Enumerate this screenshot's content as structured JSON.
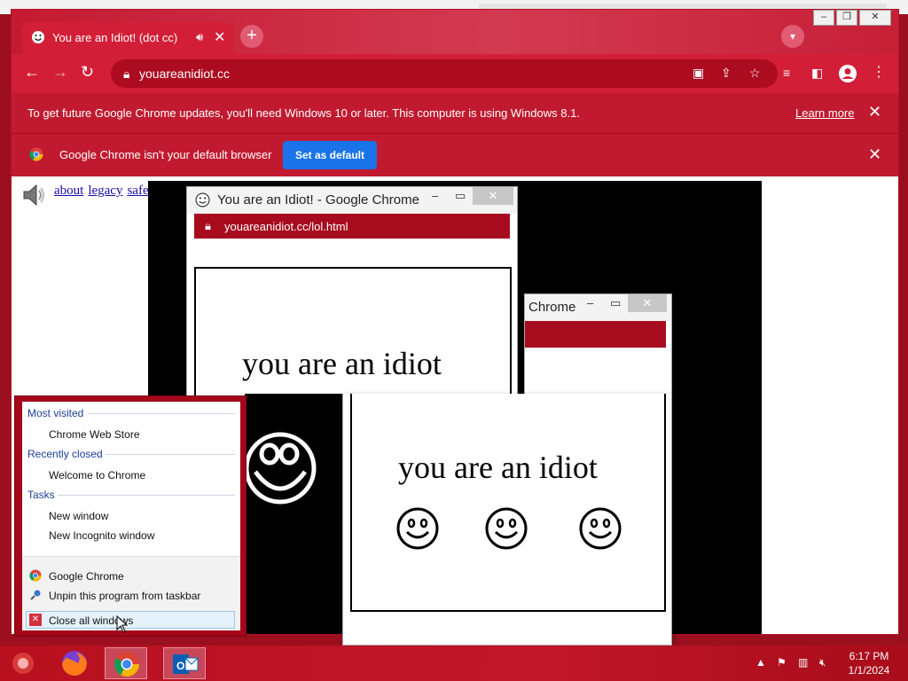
{
  "browser": {
    "tab_title": "You are an Idiot! (dot cc)",
    "url": "youareanidiot.cc",
    "update_bar": {
      "message": "To get future Google Chrome updates, you'll need Windows 10 or later. This computer is using Windows 8.1.",
      "learn_more": "Learn more"
    },
    "default_bar": {
      "message": "Google Chrome isn't your default browser",
      "button": "Set as default"
    },
    "page_links": [
      "about",
      "legacy",
      "safe"
    ]
  },
  "popup_one": {
    "title": "You are an Idiot! - Google Chrome",
    "url": "youareanidiot.cc/lol.html",
    "text": "you are an idiot"
  },
  "popup_two": {
    "title": "Chrome",
    "text": "you are an idiot"
  },
  "jumplist": {
    "most_visited_header": "Most visited",
    "most_visited": [
      "Chrome Web Store"
    ],
    "recently_closed_header": "Recently closed",
    "recently_closed": [
      "Welcome to Chrome"
    ],
    "tasks_header": "Tasks",
    "tasks": [
      "New window",
      "New Incognito window"
    ],
    "app_name": "Google Chrome",
    "unpin": "Unpin this program from taskbar",
    "close_all": "Close all windows"
  },
  "taskbar": {
    "time": "6:17 PM",
    "date": "1/1/2024"
  },
  "colors": {
    "chrome_red": "#d21f37",
    "dark_red": "#a70b1e",
    "link_blue": "#1a0dab",
    "accent_blue": "#1a73e8"
  }
}
